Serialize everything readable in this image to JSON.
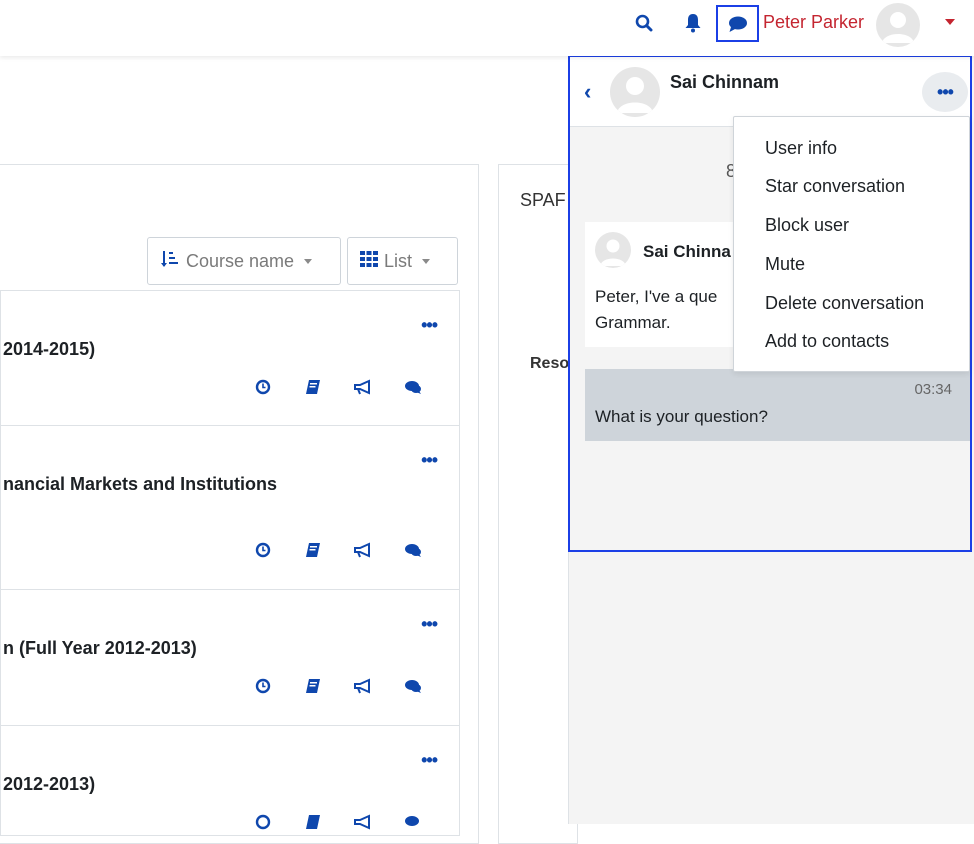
{
  "navbar": {
    "search_icon": "search-icon",
    "bell_icon": "bell-icon",
    "message_icon": "message-icon",
    "user_name": "Peter Parker"
  },
  "course_panel": {
    "sort_label": "Course name",
    "view_label": "List",
    "courses": [
      {
        "title": "2014-2015)"
      },
      {
        "title": "nancial Markets and Institutions"
      },
      {
        "title": "n (Full Year 2012-2013)"
      },
      {
        "title": "2012-2013)"
      }
    ],
    "more_label": "•••"
  },
  "middle_panel": {
    "header_text": "SPAF",
    "subheader_text": "Reso"
  },
  "conversation": {
    "contact_name": "Sai Chinnam",
    "more_label": "•••",
    "date_text": "8",
    "incoming": {
      "sender": "Sai Chinna",
      "text": "Peter, I've a que Grammar."
    },
    "outgoing": {
      "time": "03:34",
      "text": "What is your question?"
    }
  },
  "menu": {
    "items": [
      "User info",
      "Star conversation",
      "Block user",
      "Mute",
      "Delete conversation",
      "Add to contacts"
    ]
  },
  "colors": {
    "brand_red": "#c42530",
    "link_blue": "#0f47ad",
    "highlight_blue": "#1b3fe6"
  }
}
